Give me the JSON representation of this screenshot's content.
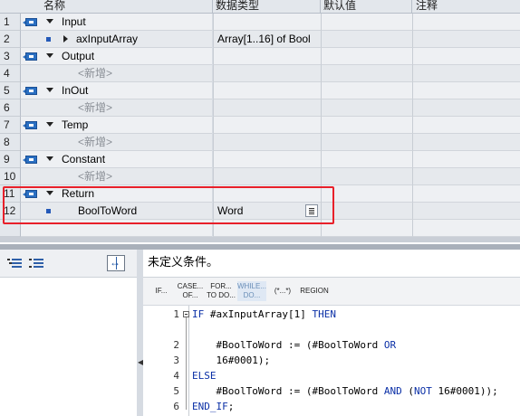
{
  "interface": {
    "columns": {
      "name": "名称",
      "datatype": "数据类型",
      "default": "默认值",
      "comment": "注释"
    },
    "rows": [
      {
        "no": "1",
        "name": "Input",
        "type": "",
        "kind": "section"
      },
      {
        "no": "2",
        "name": "axInputArray",
        "type": "Array[1..16] of Bool",
        "kind": "member-collapsed"
      },
      {
        "no": "3",
        "name": "Output",
        "type": "",
        "kind": "section"
      },
      {
        "no": "4",
        "name": "<新增>",
        "type": "",
        "kind": "add"
      },
      {
        "no": "5",
        "name": "InOut",
        "type": "",
        "kind": "section"
      },
      {
        "no": "6",
        "name": "<新增>",
        "type": "",
        "kind": "add"
      },
      {
        "no": "7",
        "name": "Temp",
        "type": "",
        "kind": "section"
      },
      {
        "no": "8",
        "name": "<新增>",
        "type": "",
        "kind": "add"
      },
      {
        "no": "9",
        "name": "Constant",
        "type": "",
        "kind": "section"
      },
      {
        "no": "10",
        "name": "<新增>",
        "type": "",
        "kind": "add"
      },
      {
        "no": "11",
        "name": "Return",
        "type": "",
        "kind": "section"
      },
      {
        "no": "12",
        "name": "BoolToWord",
        "type": "Word",
        "kind": "member"
      },
      {
        "no": "",
        "name": "",
        "type": "",
        "kind": "empty"
      }
    ]
  },
  "editor": {
    "condition_text": "未定义条件。",
    "keywords": [
      {
        "line1": "IF...",
        "line2": ""
      },
      {
        "line1": "CASE...",
        "line2": "OF..."
      },
      {
        "line1": "FOR...",
        "line2": "TO DO..."
      },
      {
        "line1": "WHILE...",
        "line2": "DO..."
      },
      {
        "line1": "(*...*)",
        "line2": ""
      },
      {
        "line1": "REGION",
        "line2": ""
      }
    ],
    "code_lines": [
      {
        "no": "1",
        "text": "IF #axInputArray[1] THEN"
      },
      {
        "no": "",
        "text": ""
      },
      {
        "no": "2",
        "text": "    #BoolToWord := (#BoolToWord OR"
      },
      {
        "no": "3",
        "text": "    16#0001);"
      },
      {
        "no": "4",
        "text": "ELSE"
      },
      {
        "no": "5",
        "text": "    #BoolToWord := (#BoolToWord AND (NOT 16#0001));"
      },
      {
        "no": "6",
        "text": "END_IF;"
      }
    ]
  },
  "icons": {
    "section": "interface-section-icon",
    "member": "variable-icon",
    "expand": "triangle-down-icon",
    "collapsed": "triangle-right-icon",
    "datatype_picker": "list-picker-icon",
    "left_toolbar": [
      "indent-icon",
      "outdent-icon",
      "split-view-icon"
    ]
  },
  "colors": {
    "highlight": "#e8202a",
    "keyword": "#0a2fa6",
    "section_icon": "#2a6fc2"
  }
}
